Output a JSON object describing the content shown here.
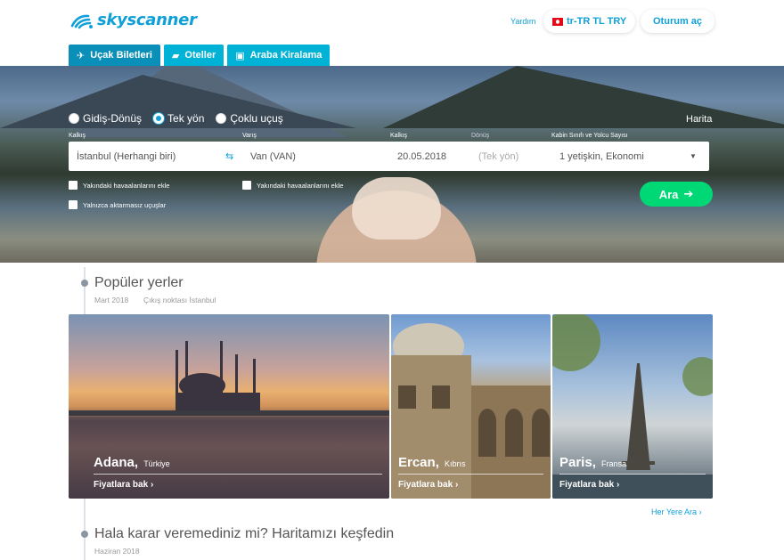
{
  "header": {
    "brand": "skyscanner",
    "help": "Yardım",
    "locale": "tr-TR TL TRY",
    "login": "Oturum aç"
  },
  "tabs": [
    {
      "label": "Uçak Biletleri",
      "icon": "plane-icon",
      "active": true
    },
    {
      "label": "Oteller",
      "icon": "bed-icon",
      "active": false
    },
    {
      "label": "Araba Kiralama",
      "icon": "car-icon",
      "active": false
    }
  ],
  "search": {
    "trip_types": [
      {
        "label": "Gidiş-Dönüş",
        "checked": false
      },
      {
        "label": "Tek yön",
        "checked": true
      },
      {
        "label": "Çoklu uçuş",
        "checked": false
      }
    ],
    "map_link": "Harita",
    "labels": {
      "from": "Kalkış",
      "to": "Varış",
      "depart": "Kalkış",
      "return": "Dönüş",
      "cabin": "Kabin Sınıfı ve Yolcu Sayısı"
    },
    "values": {
      "from": "İstanbul (Herhangi biri)",
      "to": "Van (VAN)",
      "depart": "20.05.2018",
      "return": "(Tek yön)",
      "cabin": "1 yetişkin, Ekonomi"
    },
    "checkboxes": {
      "nearby_from": "Yakındaki havaalanlarını ekle",
      "nearby_to": "Yakındaki havaalanlarını ekle",
      "direct_only": "Yalnızca aktarmasız uçuşlar"
    },
    "submit": "Ara"
  },
  "popular": {
    "title": "Popüler yerler",
    "month": "Mart 2018",
    "origin": "Çıkış noktası İstanbul",
    "destinations": [
      {
        "city": "Adana",
        "country": "Türkiye",
        "link": "Fiyatlara bak"
      },
      {
        "city": "Ercan",
        "country": "Kıbrıs",
        "link": "Fiyatlara bak"
      },
      {
        "city": "Paris",
        "country": "Fransa",
        "link": "Fiyatlara bak"
      }
    ],
    "see_all": "Her Yere Ara"
  },
  "explore": {
    "title": "Hala karar veremediniz mi? Haritamızı keşfedin",
    "month": "Haziran 2018"
  },
  "colors": {
    "brand": "#0fa0d8",
    "tab": "#00b2d6",
    "cta": "#00d775"
  }
}
